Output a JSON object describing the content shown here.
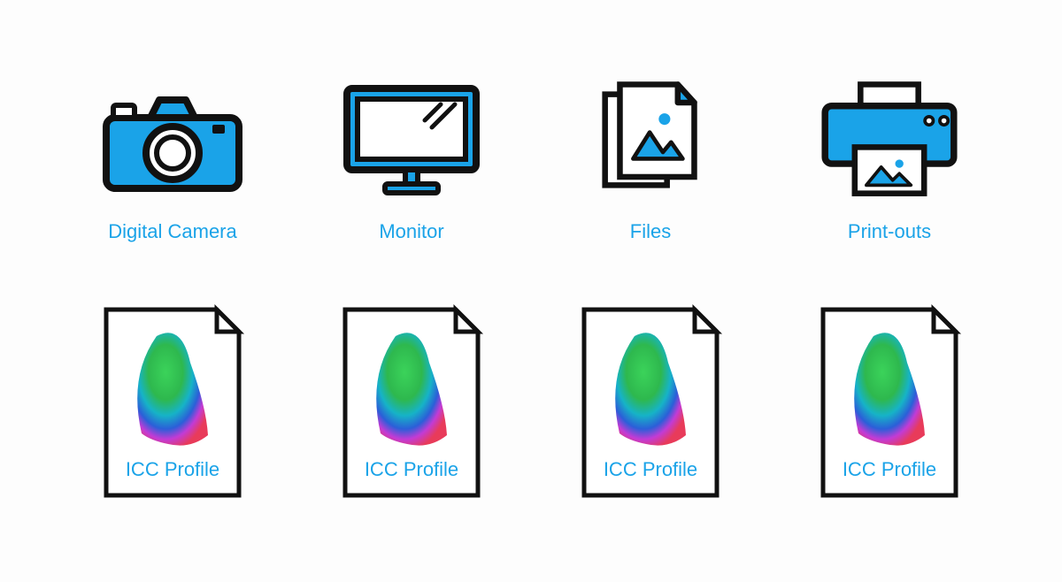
{
  "colors": {
    "accent": "#1aa3e8",
    "stroke": "#111111",
    "white": "#ffffff"
  },
  "devices": [
    {
      "id": "camera",
      "label": "Digital Camera"
    },
    {
      "id": "monitor",
      "label": "Monitor"
    },
    {
      "id": "files",
      "label": "Files"
    },
    {
      "id": "printer",
      "label": "Print-outs"
    }
  ],
  "profiles": [
    {
      "label": "ICC Profile"
    },
    {
      "label": "ICC Profile"
    },
    {
      "label": "ICC Profile"
    },
    {
      "label": "ICC Profile"
    }
  ]
}
